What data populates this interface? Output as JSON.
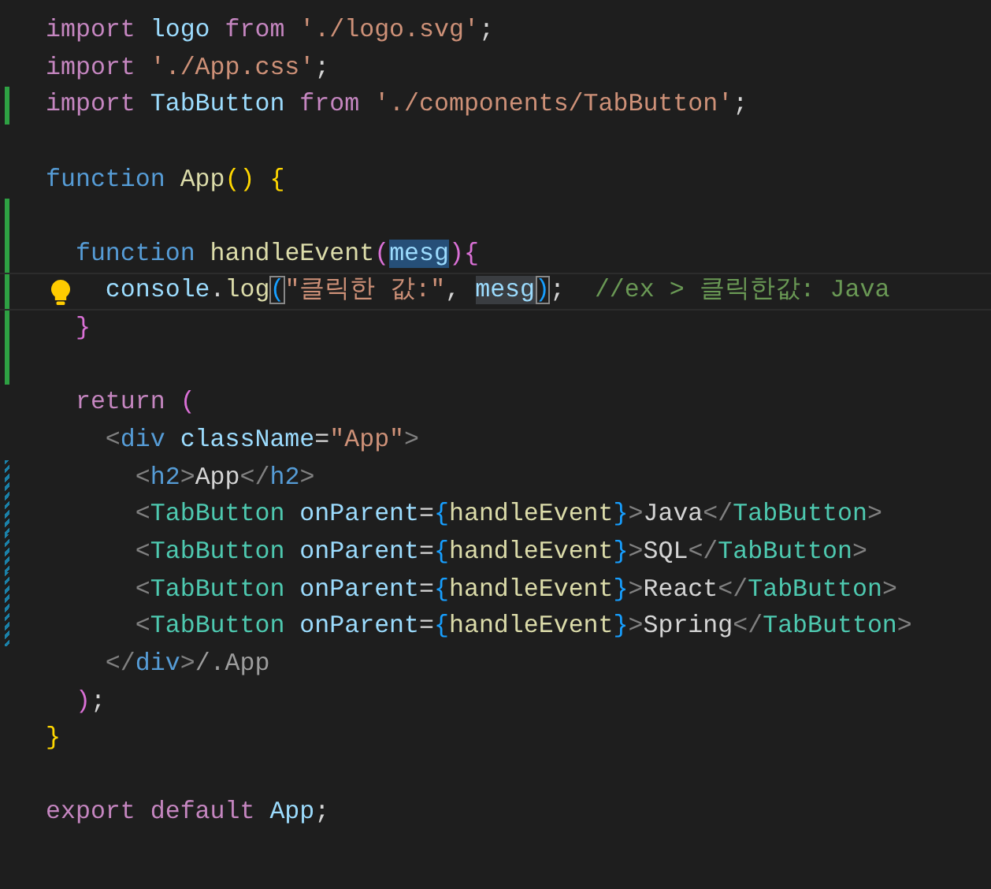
{
  "editor": {
    "lines": [
      {
        "kind": "code",
        "added": false,
        "modified": false,
        "current": false,
        "lightbulb": false,
        "tokens": [
          {
            "t": "import ",
            "kind": "kw"
          },
          {
            "t": "logo ",
            "kind": "var"
          },
          {
            "t": "from ",
            "kind": "kw"
          },
          {
            "t": "'./logo.svg'",
            "kind": "str"
          },
          {
            "t": ";",
            "kind": "plain"
          }
        ]
      },
      {
        "kind": "code",
        "added": false,
        "modified": false,
        "current": false,
        "lightbulb": false,
        "tokens": [
          {
            "t": "import ",
            "kind": "kw"
          },
          {
            "t": "'./App.css'",
            "kind": "str"
          },
          {
            "t": ";",
            "kind": "plain"
          }
        ]
      },
      {
        "kind": "code",
        "added": true,
        "modified": false,
        "current": false,
        "lightbulb": false,
        "tokens": [
          {
            "t": "import ",
            "kind": "kw"
          },
          {
            "t": "TabButton ",
            "kind": "var"
          },
          {
            "t": "from ",
            "kind": "kw"
          },
          {
            "t": "'./components/TabButton'",
            "kind": "str"
          },
          {
            "t": ";",
            "kind": "plain"
          }
        ]
      },
      {
        "kind": "blank",
        "added": false,
        "modified": false,
        "current": false,
        "lightbulb": false
      },
      {
        "kind": "code",
        "added": false,
        "modified": false,
        "current": false,
        "lightbulb": false,
        "tokens": [
          {
            "t": "function ",
            "kind": "decl"
          },
          {
            "t": "App",
            "kind": "func"
          },
          {
            "t": "() ",
            "kind": "br1"
          },
          {
            "t": "{",
            "kind": "br1"
          }
        ]
      },
      {
        "kind": "blank",
        "added": true,
        "modified": false,
        "current": false,
        "lightbulb": false
      },
      {
        "kind": "code",
        "added": true,
        "modified": false,
        "current": false,
        "lightbulb": false,
        "tokens": [
          {
            "t": "  function ",
            "kind": "decl"
          },
          {
            "t": "handleEvent",
            "kind": "func"
          },
          {
            "t": "(",
            "kind": "br2"
          },
          {
            "t": "mesg",
            "kind": "marked"
          },
          {
            "t": "){",
            "kind": "br2"
          }
        ]
      },
      {
        "kind": "code",
        "added": true,
        "modified": false,
        "current": true,
        "lightbulb": true,
        "tokens": [
          {
            "t": "    console",
            "kind": "var"
          },
          {
            "t": ".",
            "kind": "plain"
          },
          {
            "t": "log",
            "kind": "func"
          },
          {
            "t": "(",
            "kind": "match"
          },
          {
            "t": "\"클릭한 값:\"",
            "kind": "str"
          },
          {
            "t": ", ",
            "kind": "plain"
          },
          {
            "t": "mesg",
            "kind": "ref"
          },
          {
            "t": ")",
            "kind": "match"
          },
          {
            "t": ";  ",
            "kind": "plain"
          },
          {
            "t": "//ex > 클릭한값: Java",
            "kind": "cmt"
          }
        ]
      },
      {
        "kind": "code",
        "added": true,
        "modified": false,
        "current": false,
        "lightbulb": false,
        "tokens": [
          {
            "t": "  }",
            "kind": "br2"
          }
        ]
      },
      {
        "kind": "blank",
        "added": true,
        "modified": false,
        "current": false,
        "lightbulb": false
      },
      {
        "kind": "code",
        "added": false,
        "modified": false,
        "current": false,
        "lightbulb": false,
        "tokens": [
          {
            "t": "  return ",
            "kind": "kw"
          },
          {
            "t": "(",
            "kind": "br2"
          }
        ]
      },
      {
        "kind": "code",
        "added": false,
        "modified": false,
        "current": false,
        "lightbulb": false,
        "tokens": [
          {
            "t": "    <",
            "kind": "punct"
          },
          {
            "t": "div ",
            "kind": "decl"
          },
          {
            "t": "className",
            "kind": "var"
          },
          {
            "t": "=",
            "kind": "plain"
          },
          {
            "t": "\"App\"",
            "kind": "str"
          },
          {
            "t": ">",
            "kind": "punct"
          }
        ]
      },
      {
        "kind": "code",
        "added": false,
        "modified": true,
        "current": false,
        "lightbulb": false,
        "tokens": [
          {
            "t": "      <",
            "kind": "punct"
          },
          {
            "t": "h2",
            "kind": "decl"
          },
          {
            "t": ">",
            "kind": "punct"
          },
          {
            "t": "App",
            "kind": "plain"
          },
          {
            "t": "</",
            "kind": "punct"
          },
          {
            "t": "h2",
            "kind": "decl"
          },
          {
            "t": ">",
            "kind": "punct"
          }
        ]
      },
      {
        "kind": "code",
        "added": false,
        "modified": true,
        "current": false,
        "lightbulb": false,
        "tokens": [
          {
            "t": "      <",
            "kind": "punct"
          },
          {
            "t": "TabButton ",
            "kind": "comp"
          },
          {
            "t": "onParent",
            "kind": "var"
          },
          {
            "t": "=",
            "kind": "plain"
          },
          {
            "t": "{",
            "kind": "br3"
          },
          {
            "t": "handleEvent",
            "kind": "func"
          },
          {
            "t": "}",
            "kind": "br3"
          },
          {
            "t": ">",
            "kind": "punct"
          },
          {
            "t": "Java",
            "kind": "plain"
          },
          {
            "t": "</",
            "kind": "punct"
          },
          {
            "t": "TabButton",
            "kind": "comp"
          },
          {
            "t": ">",
            "kind": "punct"
          }
        ]
      },
      {
        "kind": "code",
        "added": false,
        "modified": true,
        "current": false,
        "lightbulb": false,
        "tokens": [
          {
            "t": "      <",
            "kind": "punct"
          },
          {
            "t": "TabButton ",
            "kind": "comp"
          },
          {
            "t": "onParent",
            "kind": "var"
          },
          {
            "t": "=",
            "kind": "plain"
          },
          {
            "t": "{",
            "kind": "br3"
          },
          {
            "t": "handleEvent",
            "kind": "func"
          },
          {
            "t": "}",
            "kind": "br3"
          },
          {
            "t": ">",
            "kind": "punct"
          },
          {
            "t": "SQL",
            "kind": "plain"
          },
          {
            "t": "</",
            "kind": "punct"
          },
          {
            "t": "TabButton",
            "kind": "comp"
          },
          {
            "t": ">",
            "kind": "punct"
          }
        ]
      },
      {
        "kind": "code",
        "added": false,
        "modified": true,
        "current": false,
        "lightbulb": false,
        "tokens": [
          {
            "t": "      <",
            "kind": "punct"
          },
          {
            "t": "TabButton ",
            "kind": "comp"
          },
          {
            "t": "onParent",
            "kind": "var"
          },
          {
            "t": "=",
            "kind": "plain"
          },
          {
            "t": "{",
            "kind": "br3"
          },
          {
            "t": "handleEvent",
            "kind": "func"
          },
          {
            "t": "}",
            "kind": "br3"
          },
          {
            "t": ">",
            "kind": "punct"
          },
          {
            "t": "React",
            "kind": "plain"
          },
          {
            "t": "</",
            "kind": "punct"
          },
          {
            "t": "TabButton",
            "kind": "comp"
          },
          {
            "t": ">",
            "kind": "punct"
          }
        ]
      },
      {
        "kind": "code",
        "added": false,
        "modified": true,
        "current": false,
        "lightbulb": false,
        "tokens": [
          {
            "t": "      <",
            "kind": "punct"
          },
          {
            "t": "TabButton ",
            "kind": "comp"
          },
          {
            "t": "onParent",
            "kind": "var"
          },
          {
            "t": "=",
            "kind": "plain"
          },
          {
            "t": "{",
            "kind": "br3"
          },
          {
            "t": "handleEvent",
            "kind": "func"
          },
          {
            "t": "}",
            "kind": "br3"
          },
          {
            "t": ">",
            "kind": "punct"
          },
          {
            "t": "Spring",
            "kind": "plain"
          },
          {
            "t": "</",
            "kind": "punct"
          },
          {
            "t": "TabButton",
            "kind": "comp"
          },
          {
            "t": ">",
            "kind": "punct"
          }
        ]
      },
      {
        "kind": "code",
        "added": false,
        "modified": false,
        "current": false,
        "lightbulb": false,
        "tokens": [
          {
            "t": "    </",
            "kind": "punct"
          },
          {
            "t": "div",
            "kind": "decl"
          },
          {
            "t": ">",
            "kind": "punct"
          },
          {
            "t": "/.App",
            "kind": "dim"
          }
        ]
      },
      {
        "kind": "code",
        "added": false,
        "modified": false,
        "current": false,
        "lightbulb": false,
        "tokens": [
          {
            "t": "  )",
            "kind": "br2"
          },
          {
            "t": ";",
            "kind": "plain"
          }
        ]
      },
      {
        "kind": "code",
        "added": false,
        "modified": false,
        "current": false,
        "lightbulb": false,
        "tokens": [
          {
            "t": "}",
            "kind": "br1"
          }
        ]
      },
      {
        "kind": "blank",
        "added": false,
        "modified": false,
        "current": false,
        "lightbulb": false
      },
      {
        "kind": "code",
        "added": false,
        "modified": false,
        "current": false,
        "lightbulb": false,
        "tokens": [
          {
            "t": "export default ",
            "kind": "kw"
          },
          {
            "t": "App",
            "kind": "var"
          },
          {
            "t": ";",
            "kind": "plain"
          }
        ]
      }
    ]
  }
}
